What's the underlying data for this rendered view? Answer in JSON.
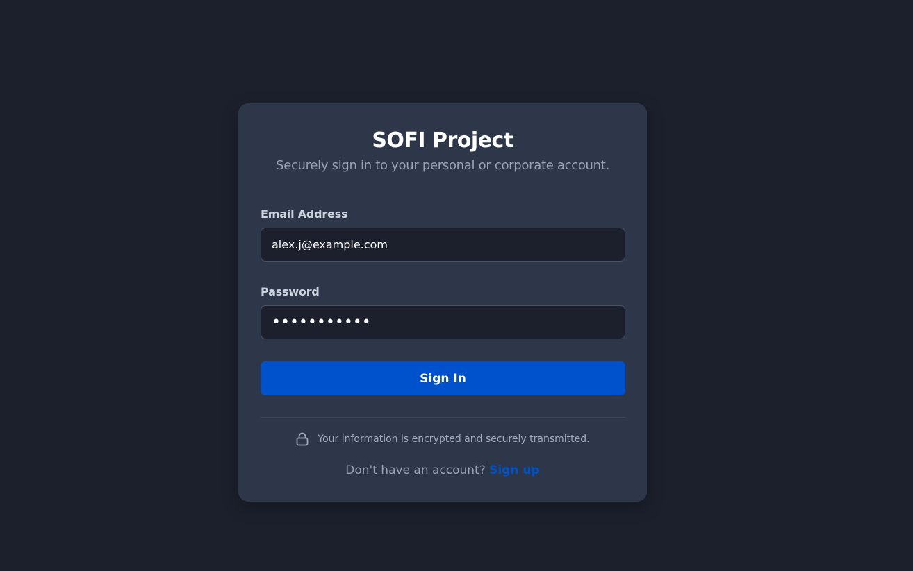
{
  "brand": {
    "title": "SOFI Project",
    "subtitle": "Securely sign in to your personal or corporate account."
  },
  "form": {
    "email_label": "Email Address",
    "email_value": "alex.j@example.com",
    "password_label": "Password",
    "password_value": "•••••••••••",
    "submit_label": "Sign In"
  },
  "footer": {
    "security_note": "Your information is encrypted and securely transmitted.",
    "security_icon": "lock-icon",
    "signup_prompt": "Don't have an account?",
    "signup_link": "Sign up"
  },
  "colors": {
    "background": "#1b202c",
    "card": "#2e3749",
    "accent": "#0052cc",
    "input_bg": "#1b202c"
  }
}
